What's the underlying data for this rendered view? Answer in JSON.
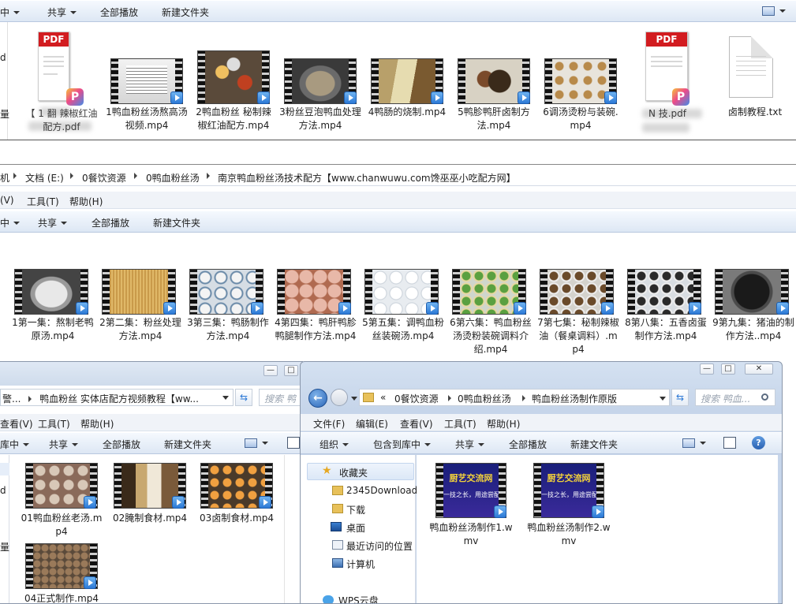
{
  "colors": {
    "toolbar_top": "#f5f9fe",
    "toolbar_bottom": "#dde7f4",
    "accent": "#2c79d6",
    "pdf_red": "#d21c20",
    "selection": "#e6eef9"
  },
  "win_top": {
    "toolbar": {
      "library": "中",
      "share": "共享",
      "play_all": "全部播放",
      "new_folder": "新建文件夹"
    },
    "left_char1": "d",
    "left_char2": "量",
    "files": [
      {
        "type": "pdf",
        "name": "【 1 翻 辣椒红油配方.pdf"
      },
      {
        "type": "video",
        "name": "1鸭血粉丝汤熬高汤视频.mp4"
      },
      {
        "type": "video",
        "name": "2鸭血粉丝 秘制辣椒红油配方.mp4"
      },
      {
        "type": "video",
        "name": "3粉丝豆泡鸭血处理方法.mp4"
      },
      {
        "type": "video",
        "name": "4鸭肠的烧制.mp4"
      },
      {
        "type": "video",
        "name": "5鸭胗鸭肝卤制方法.mp4"
      },
      {
        "type": "video",
        "name": "6调汤烫粉与装碗.mp4"
      },
      {
        "type": "pdf",
        "name": "N 技.pdf"
      },
      {
        "type": "txt",
        "name": "卤制教程.txt"
      }
    ],
    "pdf_text": "PDF",
    "wps_letter": "P"
  },
  "win_mid": {
    "breadcrumb": [
      "机",
      "文档 (E:)",
      "0餐饮资源",
      "0鸭血粉丝汤",
      "南京鸭血粉丝汤技术配方【www.chanwuwu.com馋巫巫小吃配方网】"
    ],
    "menu": [
      "(V)",
      "工具(T)",
      "帮助(H)"
    ],
    "toolbar": {
      "library": "中",
      "share": "共享",
      "play_all": "全部播放",
      "new_folder": "新建文件夹"
    },
    "files": [
      {
        "name": "1第一集：熬制老鸭原汤.mp4"
      },
      {
        "name": "2第二集：粉丝处理方法.mp4"
      },
      {
        "name": "3第三集：鸭肠制作方法.mp4"
      },
      {
        "name": "4第四集：鸭肝鸭胗鸭腿制作方法.mp4"
      },
      {
        "name": "5第五集：调鸭血粉丝装碗汤.mp4"
      },
      {
        "name": "6第六集：鸭血粉丝汤烫粉装碗调料介绍.mp4"
      },
      {
        "name": "7第七集：秘制辣椒油（餐桌调料）.mp4"
      },
      {
        "name": "8第八集：五香卤蛋制作方法.mp4"
      },
      {
        "name": "9第九集：猪油的制作方法..mp4"
      }
    ]
  },
  "win_left": {
    "address": "警... ▸ 鸭血粉丝 实体店配方视频教程【ww...",
    "addr_prefix": "警...",
    "addr_folder": "鸭血粉丝 实体店配方视频教程【ww...",
    "search_placeholder": "搜索 鸭",
    "menu": [
      "查看(V)",
      "工具(T)",
      "帮助(H)"
    ],
    "toolbar": {
      "library": "库中",
      "share": "共享",
      "play_all": "全部播放",
      "new_folder": "新建文件夹"
    },
    "left_char1": "d",
    "left_char2": "量",
    "files": [
      {
        "name": "01鸭血粉丝老汤.mp4"
      },
      {
        "name": "02腌制食材.mp4"
      },
      {
        "name": "03卤制食材.mp4"
      },
      {
        "name": "04正式制作.mp4"
      }
    ]
  },
  "win_right": {
    "address": {
      "prefix": "«",
      "parts": [
        "0餐饮资源",
        "0鸭血粉丝汤",
        "鸭血粉丝汤制作原版"
      ]
    },
    "search_placeholder": "搜索 鸭血...",
    "menu": [
      "文件(F)",
      "编辑(E)",
      "查看(V)",
      "工具(T)",
      "帮助(H)"
    ],
    "toolbar": {
      "organize": "组织",
      "include": "包含到库中",
      "share": "共享",
      "play_all": "全部播放",
      "new_folder": "新建文件夹"
    },
    "sidebar": [
      {
        "label": "收藏夹",
        "icon": "star-icon"
      },
      {
        "label": "2345Download",
        "icon": "folder-icon"
      },
      {
        "label": "下载",
        "icon": "download-icon"
      },
      {
        "label": "桌面",
        "icon": "desktop-icon"
      },
      {
        "label": "最近访问的位置",
        "icon": "recent-icon"
      },
      {
        "label": "计算机",
        "icon": "computer-icon"
      },
      {
        "label": "WPS云盘",
        "icon": "cloud-icon"
      }
    ],
    "files": [
      {
        "name": "鸭血粉丝汤制作1.wmv",
        "banner": "厨艺交流网",
        "sub": "一技之长，用途尝配"
      },
      {
        "name": "鸭血粉丝汤制作2.wmv",
        "banner": "厨艺交流网",
        "sub": "一技之长，用途尝配"
      }
    ],
    "help": "?"
  }
}
